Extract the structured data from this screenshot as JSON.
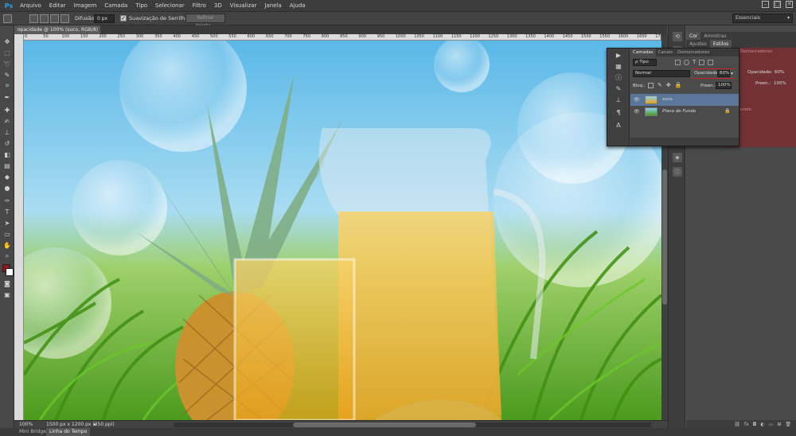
{
  "app": {
    "logo": "Ps"
  },
  "menu": [
    "Arquivo",
    "Editar",
    "Imagem",
    "Camada",
    "Tipo",
    "Selecionar",
    "Filtro",
    "3D",
    "Visualizar",
    "Janela",
    "Ajuda"
  ],
  "window_buttons": [
    "–",
    "□",
    "✕"
  ],
  "options": {
    "feather_label": "Difusão:",
    "feather_value": "0 px",
    "antialias_label": "Suavização de Serrilhado",
    "antialias_checked": true,
    "refine_label": "Refinar Aresta..."
  },
  "workspace": "Essenciais",
  "document": {
    "tab_title": "opacidade @ 100% (suco, RGB/8) *",
    "close": "×"
  },
  "ruler_ticks": [
    "0",
    "50",
    "100",
    "150",
    "200",
    "250",
    "300",
    "350",
    "400",
    "450",
    "500",
    "550",
    "600",
    "650",
    "700",
    "750",
    "800",
    "850",
    "900",
    "950",
    "1000",
    "1050",
    "1100",
    "1150",
    "1200",
    "1250",
    "1300",
    "1350",
    "1400",
    "1450",
    "1500",
    "1550",
    "1600",
    "1650",
    "1700"
  ],
  "status": {
    "zoom": "100%",
    "doc_size": "1500 px x 1200 px (350 ppi)",
    "arrow": "▸"
  },
  "bottom_tabs": [
    {
      "label": "Mini Bridge",
      "active": false
    },
    {
      "label": "Linha do Tempo",
      "active": true
    }
  ],
  "right_panel": {
    "tabs_top": [
      {
        "label": "Cor",
        "active": true
      },
      {
        "label": "Amostras",
        "active": false
      }
    ],
    "tabs_mid": [
      {
        "label": "Ajustes",
        "active": false
      },
      {
        "label": "Estilos",
        "active": true
      }
    ]
  },
  "layers_panel": {
    "tabs": [
      {
        "label": "Camadas",
        "active": true
      },
      {
        "label": "Canais",
        "active": false
      },
      {
        "label": "Demarcadores",
        "active": false
      }
    ],
    "filter_kind": "ρ Tipo",
    "blend_mode": "Normal",
    "opacity_label": "Opacidade:",
    "opacity_value": "60%",
    "lock_label": "Bloq.:",
    "fill_label": "Preen.:",
    "fill_value": "100%",
    "layers": [
      {
        "name": "suco",
        "selected": true,
        "locked": false
      },
      {
        "name": "Plano de Fundo",
        "selected": false,
        "locked": true
      }
    ]
  },
  "ghost_panel": {
    "opacity_label": "Opacidade:",
    "opacity_value": "60%",
    "fill_label": "Preen.:",
    "fill_value": "100%",
    "demarcadores": "Demarcadores",
    "fundo": "undo"
  },
  "colors": {
    "foreground": "#8b1a1a",
    "background": "#ffffff",
    "highlight": "#d0202a"
  }
}
